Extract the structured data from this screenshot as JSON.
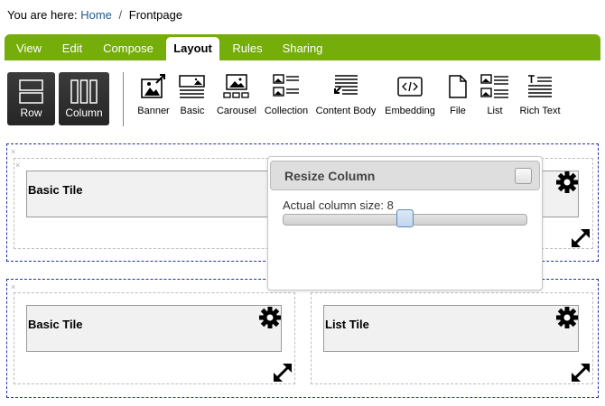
{
  "breadcrumb": {
    "prefix": "You are here:",
    "home": "Home",
    "separator": "/",
    "current": "Frontpage"
  },
  "tabs": [
    {
      "label": "View",
      "active": false
    },
    {
      "label": "Edit",
      "active": false
    },
    {
      "label": "Compose",
      "active": false
    },
    {
      "label": "Layout",
      "active": true
    },
    {
      "label": "Rules",
      "active": false
    },
    {
      "label": "Sharing",
      "active": false
    }
  ],
  "toolbar": {
    "row_label": "Row",
    "column_label": "Column",
    "tiles": [
      {
        "label": "Banner",
        "icon": "banner-icon"
      },
      {
        "label": "Basic",
        "icon": "basic-icon"
      },
      {
        "label": "Carousel",
        "icon": "carousel-icon"
      },
      {
        "label": "Collection",
        "icon": "collection-icon"
      },
      {
        "label": "Content Body",
        "icon": "content-body-icon"
      },
      {
        "label": "Embedding",
        "icon": "embedding-icon"
      },
      {
        "label": "File",
        "icon": "file-icon"
      },
      {
        "label": "List",
        "icon": "list-icon"
      },
      {
        "label": "Rich Text",
        "icon": "rich-text-icon"
      }
    ]
  },
  "layout": {
    "row1": {
      "tile_title": "Basic Tile"
    },
    "row2": {
      "left_tile_title": "Basic Tile",
      "right_tile_title": "List Tile"
    },
    "remove_mark": "×"
  },
  "resize_popup": {
    "title": "Resize Column",
    "label": "Actual column size: 8",
    "slider_value": 8,
    "slider_max": 16
  },
  "colors": {
    "tab_bar": "#75ad0a",
    "row_border": "#20339a",
    "link": "#205c90"
  }
}
